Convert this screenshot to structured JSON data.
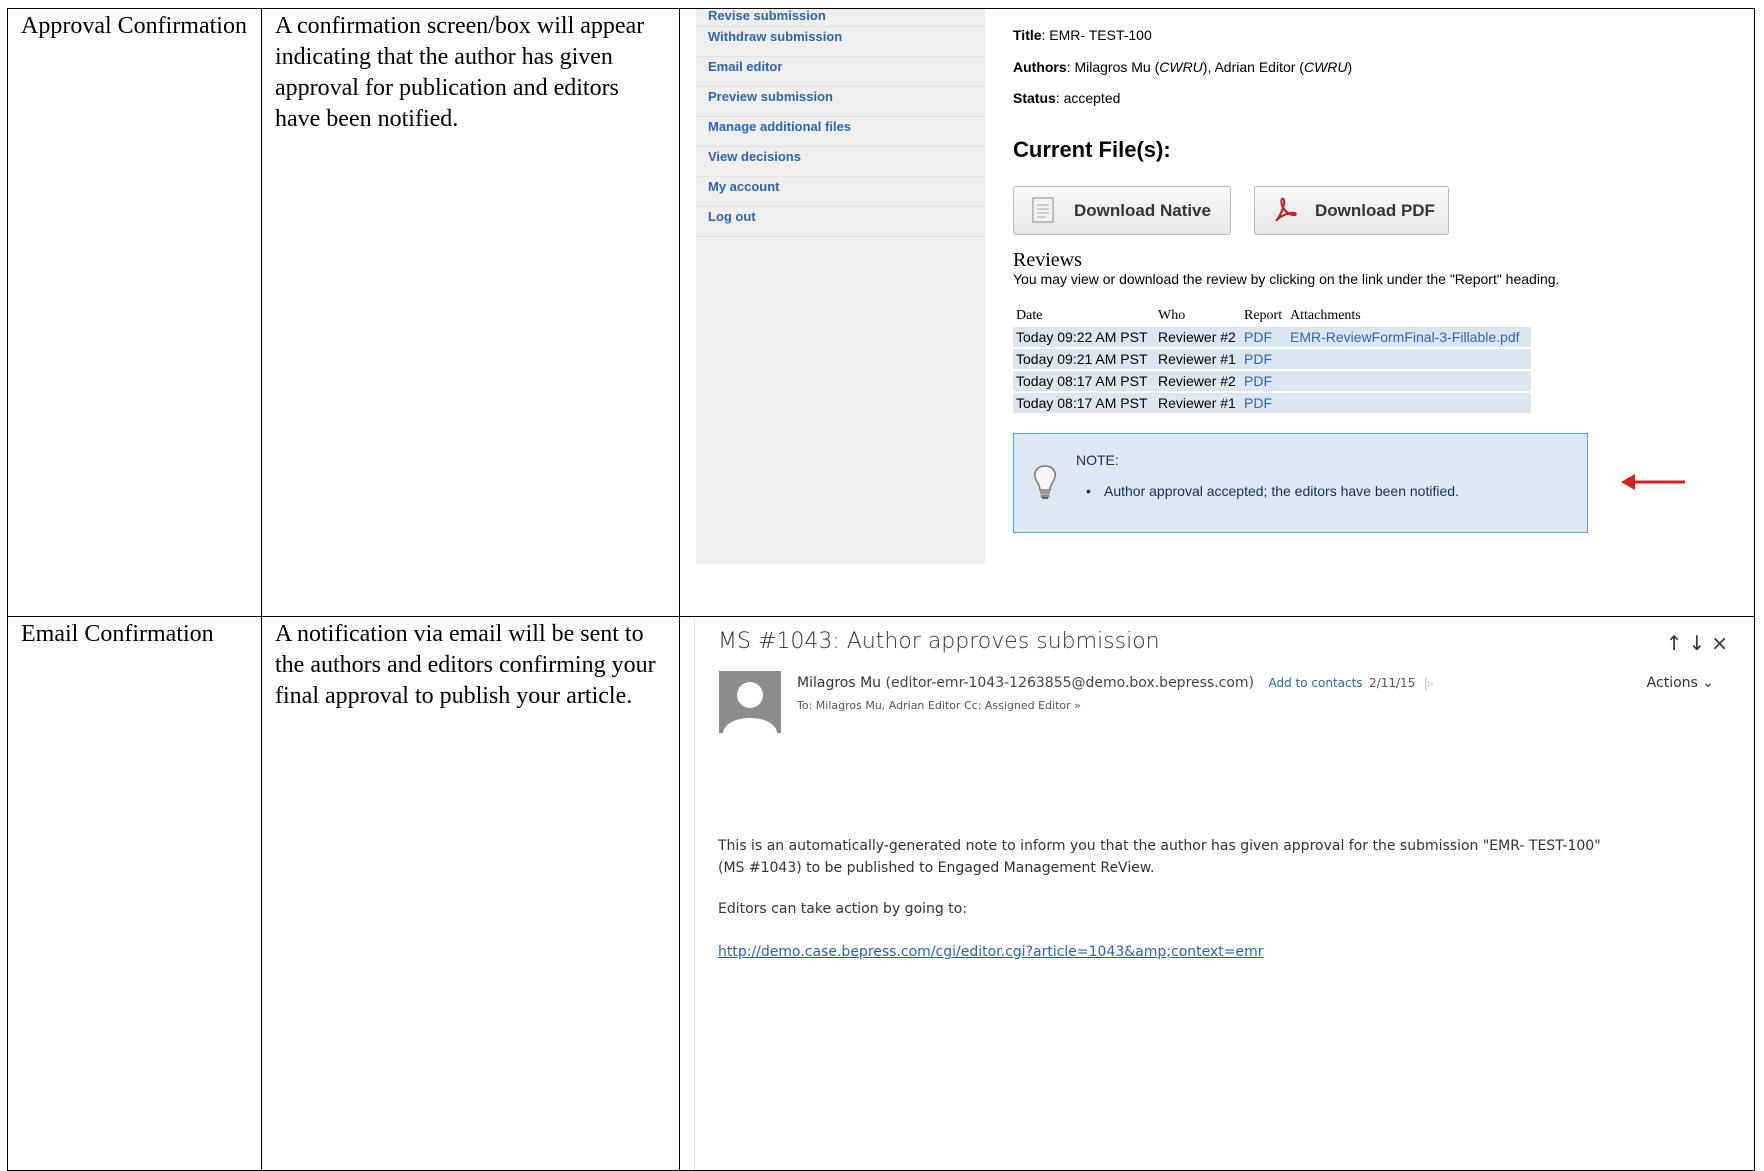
{
  "rows": [
    {
      "step": "Approval Confirmation",
      "description": "A confirmation screen/box will appear indicating that the author has given approval for publication and editors have been notified."
    },
    {
      "step": "Email Confirmation",
      "description": "A notification via email will be sent to the authors and editors confirming your final approval to publish your article."
    }
  ],
  "submission_page": {
    "sidebar_items": [
      "Revise submission",
      "Withdraw submission",
      "Email editor",
      "Preview submission",
      "Manage additional files",
      "View decisions",
      "My account",
      "Log out"
    ],
    "title_label": "Title",
    "title_value": ": EMR- TEST-100",
    "authors_label": "Authors",
    "authors_a": ": Milagros Mu (",
    "authors_a_inst": "CWRU",
    "authors_b": "), Adrian Editor (",
    "authors_b_inst": "CWRU",
    "authors_c": ")",
    "status_label": "Status",
    "status_value": ": accepted",
    "current_files": "Current File(s):",
    "download_native": "Download Native",
    "download_pdf": "Download PDF",
    "reviews_heading": "Reviews",
    "reviews_text": "You may view or download the review by clicking on the link under the \"Report\" heading.",
    "reviews_columns": [
      "Date",
      "Who",
      "Report",
      "Attachments"
    ],
    "reviews_rows": [
      {
        "date": "Today 09:22 AM PST",
        "who": "Reviewer #2",
        "report": "PDF",
        "attachment": "EMR-ReviewFormFinal-3-Fillable.pdf"
      },
      {
        "date": "Today 09:21 AM PST",
        "who": "Reviewer #1",
        "report": "PDF",
        "attachment": ""
      },
      {
        "date": "Today 08:17 AM PST",
        "who": "Reviewer #2",
        "report": "PDF",
        "attachment": ""
      },
      {
        "date": "Today 08:17 AM PST",
        "who": "Reviewer #1",
        "report": "PDF",
        "attachment": ""
      }
    ],
    "note_title": "NOTE:",
    "note_item": "Author approval accepted; the editors have been notified.",
    "arrow_color": "#d81f1f"
  },
  "email": {
    "subject": "MS #1043: Author approves submission",
    "sender_name": "Milagros Mu",
    "sender_address": "(editor-emr-1043-1263855@demo.box.bepress.com)",
    "add_to_contacts": "Add to contacts",
    "date": "2/11/15",
    "actions": "Actions",
    "to_line": "To: Milagros Mu, Adrian Editor  Cc: Assigned Editor",
    "body_1": "This is an automatically-generated note to inform you that the author has given approval for the submission \"EMR- TEST-100\" (MS #1043) to be published to Engaged Management ReView.",
    "body_2": "Editors can take action by going to:",
    "body_link": "http://demo.case.bepress.com/cgi/editor.cgi?article=1043&amp;context=emr"
  }
}
